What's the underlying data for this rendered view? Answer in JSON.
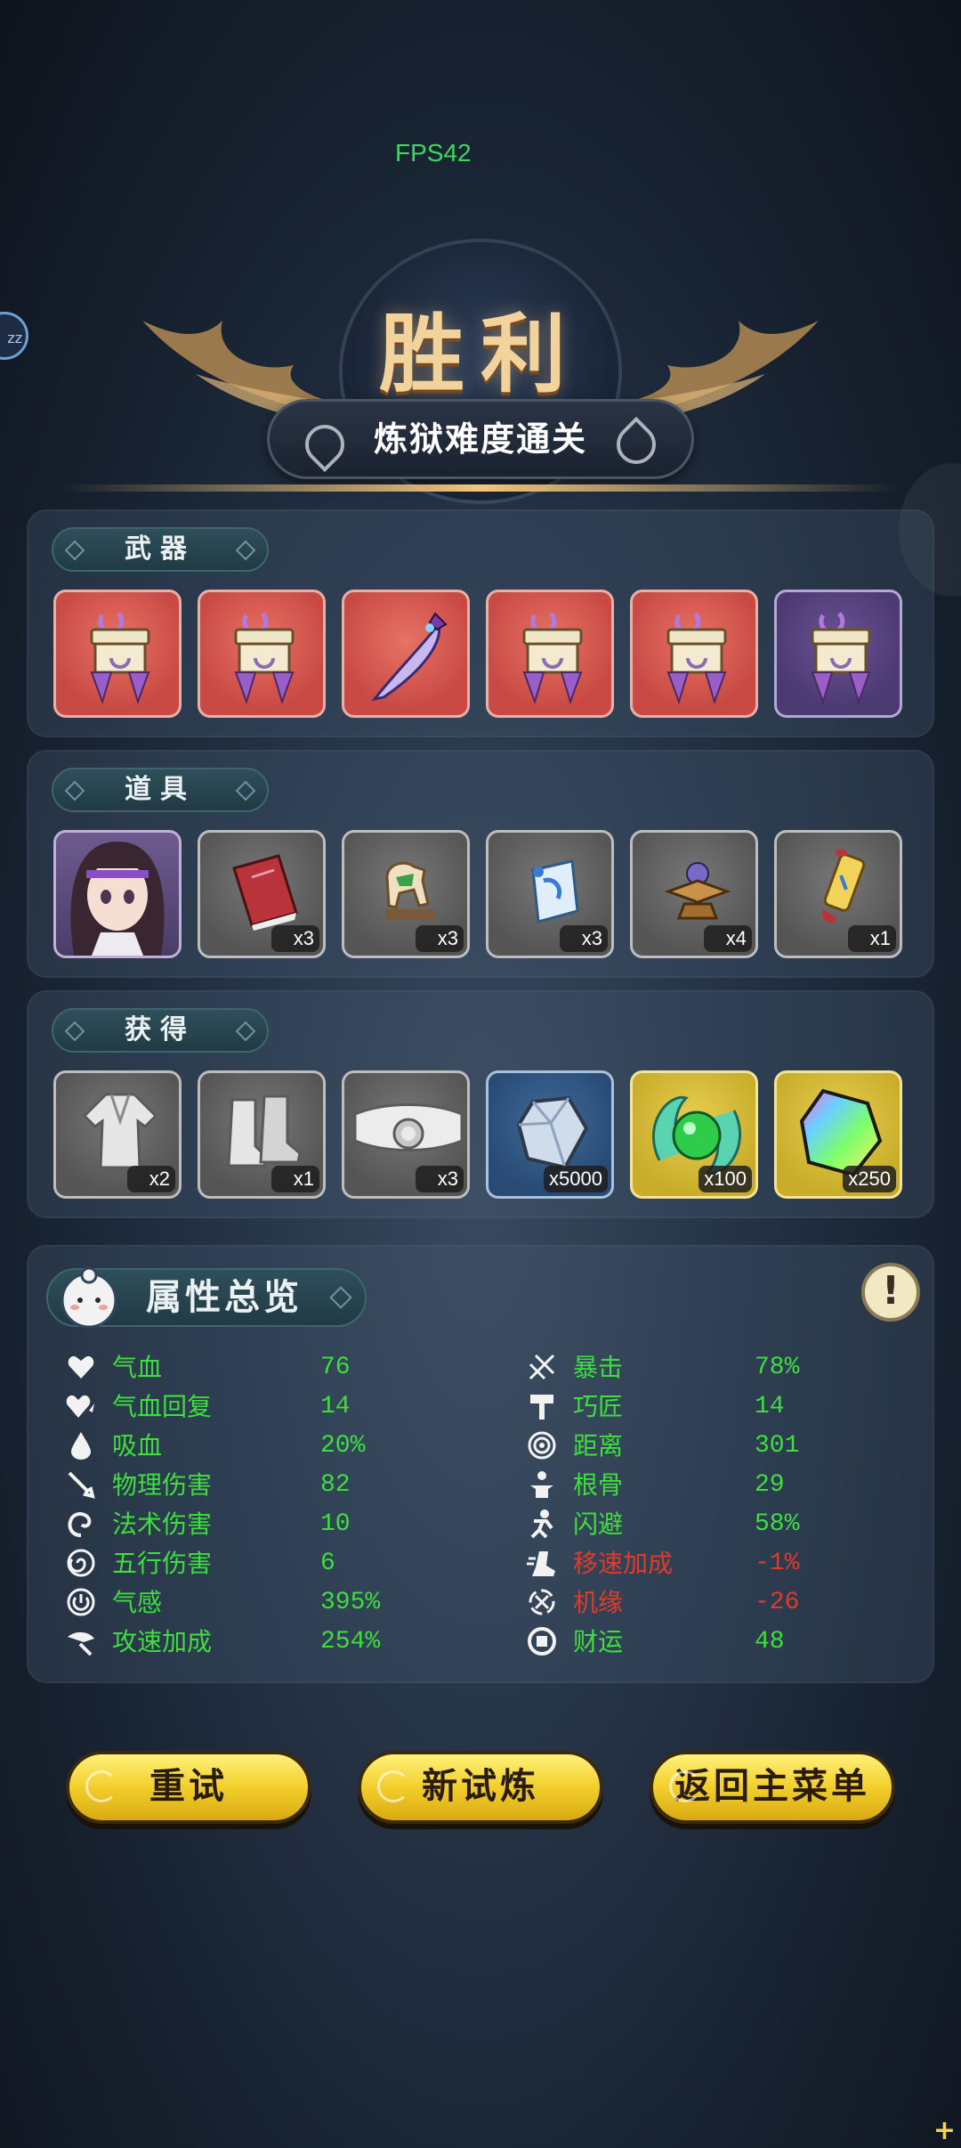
{
  "hud": {
    "fps": "FPS42",
    "side_bubble": "zz"
  },
  "header": {
    "title": "胜利",
    "subtitle": "炼狱难度通关"
  },
  "weapons": {
    "label": "武器",
    "items": [
      {
        "icon": "ornate-chest-icon",
        "bg": "red"
      },
      {
        "icon": "ornate-chest-icon",
        "bg": "red"
      },
      {
        "icon": "curved-sword-icon",
        "bg": "red"
      },
      {
        "icon": "ornate-chest-icon",
        "bg": "red"
      },
      {
        "icon": "ornate-chest-icon",
        "bg": "red"
      },
      {
        "icon": "ornate-chest-icon",
        "bg": "purple"
      }
    ]
  },
  "items": {
    "label": "道具",
    "slots": [
      {
        "icon": "character-portrait",
        "qty": ""
      },
      {
        "icon": "red-book-icon",
        "qty": "x3"
      },
      {
        "icon": "horse-figure-icon",
        "qty": "x3"
      },
      {
        "icon": "blue-scroll-icon",
        "qty": "x3"
      },
      {
        "icon": "orb-pedestal-icon",
        "qty": "x4"
      },
      {
        "icon": "golden-token-icon",
        "qty": "x1"
      }
    ]
  },
  "rewards": {
    "label": "获得",
    "slots": [
      {
        "icon": "robe-icon",
        "qty": "x2",
        "bg": "gray"
      },
      {
        "icon": "boots-icon",
        "qty": "x1",
        "bg": "gray"
      },
      {
        "icon": "belt-icon",
        "qty": "x3",
        "bg": "gray"
      },
      {
        "icon": "crystal-icon",
        "qty": "x5000",
        "bg": "blue"
      },
      {
        "icon": "jade-orb-icon",
        "qty": "x100",
        "bg": "gold"
      },
      {
        "icon": "rainbow-gem-icon",
        "qty": "x250",
        "bg": "gold"
      }
    ]
  },
  "attributes": {
    "label": "属性总览",
    "left": [
      {
        "name": "气血",
        "value": "76",
        "icon": "heart-icon"
      },
      {
        "name": "气血回复",
        "value": "14",
        "icon": "heart-regen-icon"
      },
      {
        "name": "吸血",
        "value": "20%",
        "icon": "drop-icon"
      },
      {
        "name": "物理伤害",
        "value": "82",
        "icon": "sword-icon"
      },
      {
        "name": "法术伤害",
        "value": "10",
        "icon": "swirl-icon"
      },
      {
        "name": "五行伤害",
        "value": "6",
        "icon": "spiral-icon"
      },
      {
        "name": "气感",
        "value": "395%",
        "icon": "power-icon"
      },
      {
        "name": "攻速加成",
        "value": "254%",
        "icon": "blade-speed-icon"
      }
    ],
    "right": [
      {
        "name": "暴击",
        "value": "78%",
        "icon": "crit-icon",
        "tone": "green"
      },
      {
        "name": "巧匠",
        "value": "14",
        "icon": "hammer-icon",
        "tone": "green"
      },
      {
        "name": "距离",
        "value": "301",
        "icon": "target-icon",
        "tone": "green"
      },
      {
        "name": "根骨",
        "value": "29",
        "icon": "body-icon",
        "tone": "green"
      },
      {
        "name": "闪避",
        "value": "58%",
        "icon": "dodge-icon",
        "tone": "green"
      },
      {
        "name": "移速加成",
        "value": "-1%",
        "icon": "boot-speed-icon",
        "tone": "red"
      },
      {
        "name": "机缘",
        "value": "-26",
        "icon": "luck-icon",
        "tone": "red"
      },
      {
        "name": "财运",
        "value": "48",
        "icon": "coin-icon",
        "tone": "green"
      }
    ]
  },
  "buttons": {
    "retry": "重试",
    "new_trial": "新试炼",
    "main_menu": "返回主菜单"
  },
  "colors": {
    "positive": "#3ddf3d",
    "negative": "#e03b2a",
    "button": "#f2cf2c",
    "accent_gold": "#f2d39c"
  }
}
